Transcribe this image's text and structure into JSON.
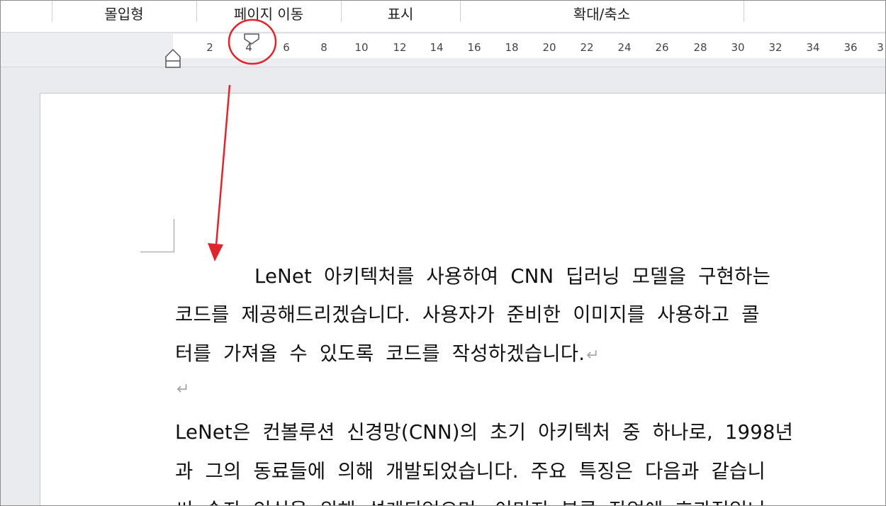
{
  "ribbon": {
    "groups": [
      "몰입형",
      "페이지 이동",
      "표시",
      "확대/축소"
    ]
  },
  "ruler": {
    "ticks": [
      "2",
      "4",
      "6",
      "8",
      "10",
      "12",
      "14",
      "16",
      "18",
      "20",
      "22",
      "24",
      "26",
      "28",
      "30",
      "32",
      "34",
      "36",
      "3"
    ]
  },
  "document": {
    "lines": [
      "LeNet 아키텍처를 사용하여 CNN 딥러닝 모델을 구현하는",
      "코드를 제공해드리겠습니다. 사용자가 준비한 이미지를 사용하고 콜",
      "터를 가져올 수 있도록 코드를 작성하겠습니다.",
      "",
      "LeNet은 컨볼루션 신경망(CNN)의 초기 아키텍처 중 하나로, 1998년",
      "과 그의 동료들에 의해 개발되었습니다. 주요 특징은 다음과 같습니",
      "씨 숫자 인식을 위해 설계되었으며, 이미지 분류 작업에 효과적입니"
    ],
    "paragraph_mark": "↵"
  },
  "colors": {
    "annotation": "#e0242b"
  }
}
